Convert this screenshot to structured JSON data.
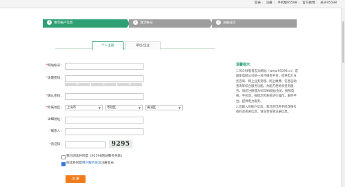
{
  "topnav": {
    "login": "登录",
    "register": "注册",
    "phone": "手机版95598",
    "wechat": "官方微博",
    "about": "关于95598"
  },
  "steps": [
    {
      "num": "1",
      "label": "填写账户信息"
    },
    {
      "num": "2",
      "label": "激活帐号"
    },
    {
      "num": "3",
      "label": "注册成功"
    }
  ],
  "tabs": {
    "personal": "个人注册",
    "company": "单位/企业"
  },
  "form": {
    "account_label": "网站帐号：",
    "password_label": "设置密码：",
    "strength": [
      "弱",
      "中",
      "强"
    ],
    "confirm_label": "确认密码：",
    "region_label": "所属地区：",
    "region_values": [
      "上海市",
      "市辖区",
      "黄浦区"
    ],
    "address_label": "详细地址：",
    "contact_label": "联系人：",
    "captcha_label": "验证码：",
    "captcha_text": "9295",
    "subscribe_text": "我已阅读并同意《95598网站服务条款》",
    "agree_text": "阅读并同意",
    "agree_link": "用户服务协议",
    "agree_suffix": "注册会员",
    "submit_label": "注 册"
  },
  "tips": {
    "title": "温馨提示：",
    "lines": [
      "1.95598智能互动网站（www.95598.cn）是国家电网公司统一对外服务平台，提供电力业务咨询、网上业务受理、网上缴费、信息自助查询等综合服务功能。为能方便地享受到服务，请您注册成为95598网站会员，按照电视、手机等，按提示和系统进行操作，服务平台，提供电力服务。",
      "2.您输入的账户信息，激活后可用于修改账号密码及相关信息，请妥善保管注册信息。"
    ]
  }
}
